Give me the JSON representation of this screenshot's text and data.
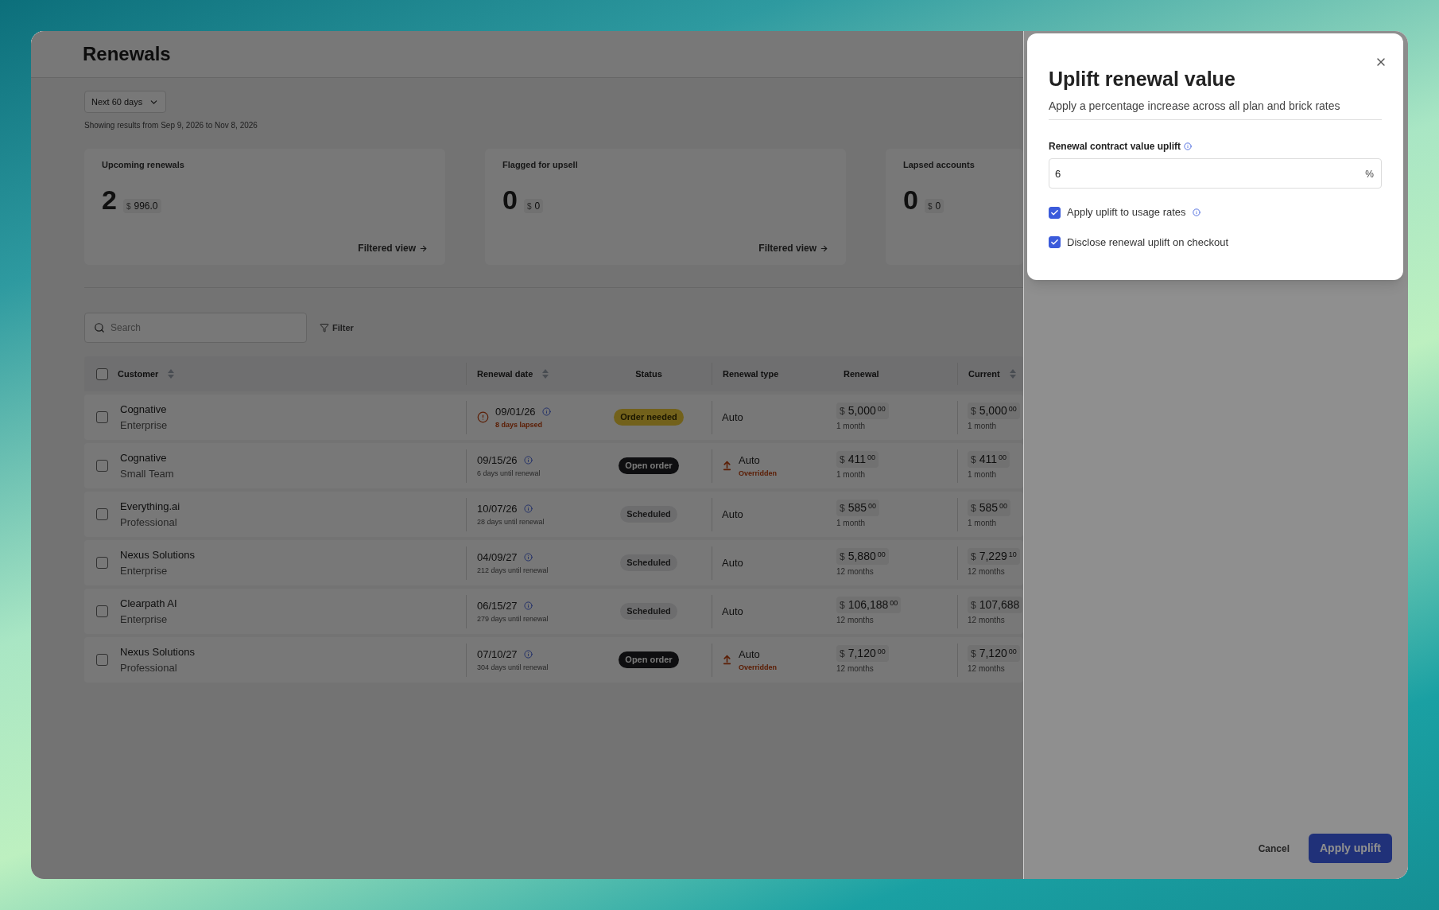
{
  "page": {
    "title": "Renewals",
    "range_dropdown": "Next 60 days",
    "range_note": "Showing results from Sep 9, 2026 to Nov 8, 2026"
  },
  "cards": [
    {
      "label": "Upcoming renewals",
      "count": "2",
      "currency": "$",
      "amount": "996.0",
      "link": "Filtered view"
    },
    {
      "label": "Flagged for upsell",
      "count": "0",
      "currency": "$",
      "amount": "0",
      "link": "Filtered view"
    },
    {
      "label": "Lapsed accounts",
      "count": "0",
      "currency": "$",
      "amount": "0"
    }
  ],
  "search": {
    "placeholder": "Search"
  },
  "filter": {
    "label": "Filter"
  },
  "table": {
    "select_all": {
      "checked": false
    },
    "columns": [
      {
        "label": "Customer",
        "sortable": true
      },
      {
        "label": "Renewal date",
        "sortable": true
      },
      {
        "label": "Status",
        "sortable": false
      },
      {
        "label": "Renewal type",
        "sortable": false
      },
      {
        "label": "Renewal",
        "sortable": false
      },
      {
        "label": "Current",
        "sortable": true
      }
    ],
    "rows": [
      {
        "selected": false,
        "customer": "Cognative",
        "plan": "Enterprise",
        "date": "09/01/26",
        "date_note": "8 days lapsed",
        "alert": true,
        "status": {
          "label": "Order needed",
          "kind": "warning"
        },
        "type": "Auto",
        "overridden": false,
        "renewal": {
          "currency": "$",
          "value": "5,000",
          "cents": "00",
          "term": "1 month"
        },
        "current": {
          "currency": "$",
          "value": "5,000",
          "cents": "00",
          "term": "1 month"
        }
      },
      {
        "selected": false,
        "customer": "Cognative",
        "plan": "Small Team",
        "date": "09/15/26",
        "date_note": "6 days until renewal",
        "alert": false,
        "status": {
          "label": "Open order",
          "kind": "dark"
        },
        "type": "Auto",
        "overridden": true,
        "type_note": "Overridden",
        "renewal": {
          "currency": "$",
          "value": "411",
          "cents": "00",
          "term": "1 month"
        },
        "current": {
          "currency": "$",
          "value": "411",
          "cents": "00",
          "term": "1 month"
        }
      },
      {
        "selected": false,
        "customer": "Everything.ai",
        "plan": "Professional",
        "date": "10/07/26",
        "date_note": "28 days until renewal",
        "alert": false,
        "status": {
          "label": "Scheduled",
          "kind": "neutral"
        },
        "type": "Auto",
        "overridden": false,
        "renewal": {
          "currency": "$",
          "value": "585",
          "cents": "00",
          "term": "1 month"
        },
        "current": {
          "currency": "$",
          "value": "585",
          "cents": "00",
          "term": "1 month"
        }
      },
      {
        "selected": false,
        "customer": "Nexus Solutions",
        "plan": "Enterprise",
        "date": "04/09/27",
        "date_note": "212 days until renewal",
        "alert": false,
        "status": {
          "label": "Scheduled",
          "kind": "neutral"
        },
        "type": "Auto",
        "overridden": false,
        "renewal": {
          "currency": "$",
          "value": "5,880",
          "cents": "00",
          "term": "12 months"
        },
        "current": {
          "currency": "$",
          "value": "7,229",
          "cents": "10",
          "term": "12 months"
        }
      },
      {
        "selected": false,
        "customer": "Clearpath AI",
        "plan": "Enterprise",
        "date": "06/15/27",
        "date_note": "279 days until renewal",
        "alert": false,
        "status": {
          "label": "Scheduled",
          "kind": "neutral"
        },
        "type": "Auto",
        "overridden": false,
        "renewal": {
          "currency": "$",
          "value": "106,188",
          "cents": "00",
          "term": "12 months"
        },
        "current": {
          "currency": "$",
          "value": "107,688",
          "term": "12 months"
        }
      },
      {
        "selected": false,
        "customer": "Nexus Solutions",
        "plan": "Professional",
        "date": "07/10/27",
        "date_note": "304 days until renewal",
        "alert": false,
        "status": {
          "label": "Open order",
          "kind": "dark"
        },
        "type": "Auto",
        "overridden": true,
        "type_note": "Overridden",
        "renewal": {
          "currency": "$",
          "value": "7,120",
          "cents": "00",
          "term": "12 months"
        },
        "current": {
          "currency": "$",
          "value": "7,120",
          "cents": "00",
          "term": "12 months"
        }
      }
    ]
  },
  "dialog": {
    "title": "Uplift renewal value",
    "subtitle": "Apply a percentage increase across all plan and brick rates",
    "field_label": "Renewal contract value uplift",
    "value": "6",
    "suffix": "%",
    "options": [
      {
        "label": "Apply uplift to usage rates",
        "checked": true,
        "info": true
      },
      {
        "label": "Disclose renewal uplift on checkout",
        "checked": true,
        "info": false
      }
    ]
  },
  "footer": {
    "cancel": "Cancel",
    "apply": "Apply uplift"
  }
}
